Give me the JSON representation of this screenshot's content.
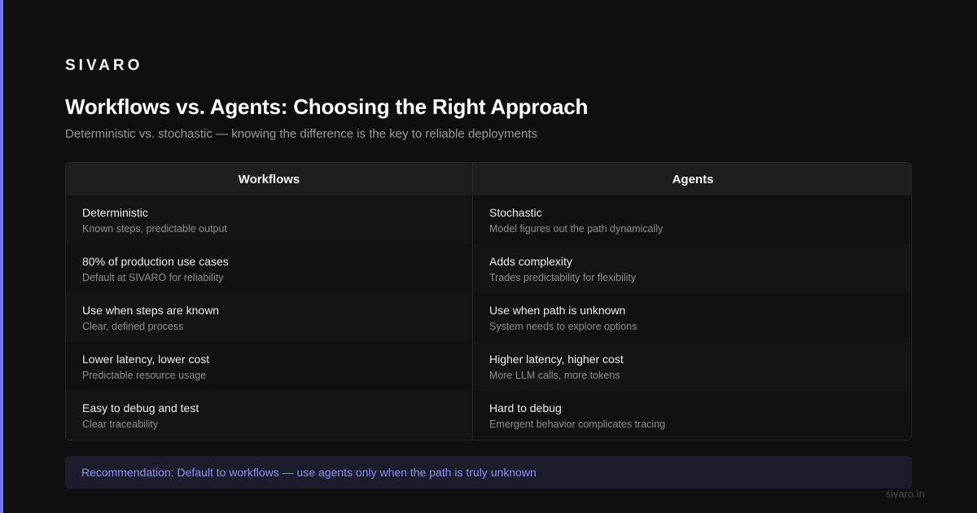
{
  "brand": "SIVARO",
  "title": "Workflows vs. Agents: Choosing the Right Approach",
  "subtitle": "Deterministic vs. stochastic — knowing the difference is the key to reliable deployments",
  "colors": {
    "accent": "#6f74e8",
    "background": "#0f0f0f",
    "recommendation_text": "#8a8ff0"
  },
  "table": {
    "left": {
      "header": "Workflows",
      "rows": [
        {
          "title": "Deterministic",
          "sub": "Known steps, predictable output"
        },
        {
          "title": "80% of production use cases",
          "sub": "Default at SIVARO for reliability"
        },
        {
          "title": "Use when steps are known",
          "sub": "Clear, defined process"
        },
        {
          "title": "Lower latency, lower cost",
          "sub": "Predictable resource usage"
        },
        {
          "title": "Easy to debug and test",
          "sub": "Clear traceability"
        }
      ]
    },
    "right": {
      "header": "Agents",
      "rows": [
        {
          "title": "Stochastic",
          "sub": "Model figures out the path dynamically"
        },
        {
          "title": "Adds complexity",
          "sub": "Trades predictability for flexibility"
        },
        {
          "title": "Use when path is unknown",
          "sub": "System needs to explore options"
        },
        {
          "title": "Higher latency, higher cost",
          "sub": "More LLM calls, more tokens"
        },
        {
          "title": "Hard to debug",
          "sub": "Emergent behavior complicates tracing"
        }
      ]
    }
  },
  "recommendation": "Recommendation: Default to workflows — use agents only when the path is truly unknown",
  "footer_url": "sivaro.in"
}
